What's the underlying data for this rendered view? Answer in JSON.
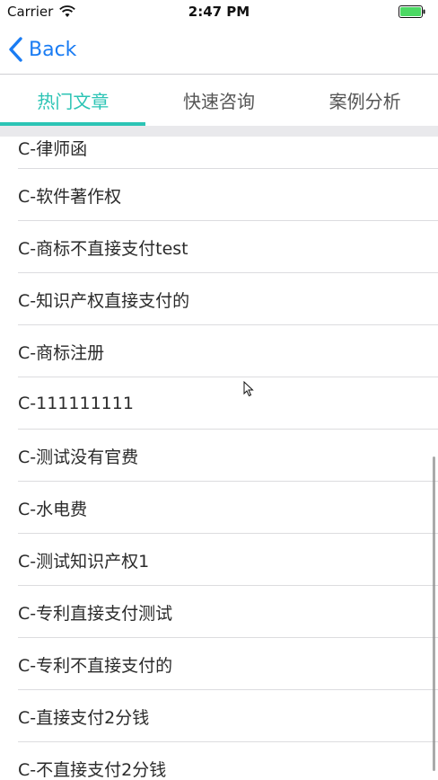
{
  "status_bar": {
    "carrier": "Carrier",
    "time": "2:47 PM",
    "battery_color": "#4cd964"
  },
  "nav": {
    "back_label": "Back",
    "accent_color": "#1a7cf3"
  },
  "tabs": [
    {
      "label": "热门文章",
      "active": true
    },
    {
      "label": "快速咨询",
      "active": false
    },
    {
      "label": "案例分析",
      "active": false
    }
  ],
  "tab_accent_color": "#2cc4b5",
  "articles": [
    "C-律师函",
    "C-软件著作权",
    "C-商标不直接支付test",
    "C-知识产权直接支付的",
    "C-商标注册",
    "C-111111111",
    "C-测试没有官费",
    "C-水电费",
    "C-测试知识产权1",
    "C-专利直接支付测试",
    "C-专利不直接支付的",
    "C-直接支付2分钱",
    "C-不直接支付2分钱"
  ]
}
